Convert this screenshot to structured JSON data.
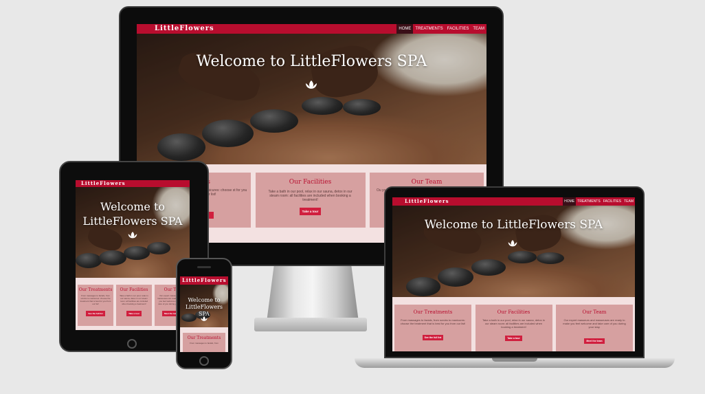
{
  "site": {
    "logo": "LittleFlowers",
    "nav": [
      "HOME",
      "TREATMENTS",
      "FACILITIES",
      "TEAM"
    ],
    "hero_title": "Welcome to LittleFlowers SPA",
    "cards": [
      {
        "title": "Our Treatments",
        "text": "From massages to facials, from scrubs to manicures: choose the treatment that is best for you from our list!",
        "button": "See the full list"
      },
      {
        "title": "Our Facilities",
        "text": "Take a bath in our pool, relax in our sauna, detox in our steam room: all facilities are included when booking a treatment!",
        "button": "Take a tour"
      },
      {
        "title": "Our Team",
        "text": "Our expert masseurs and masseuses are ready to make you feel welcome and take care of you during your stay.",
        "button": "Meet the team"
      }
    ],
    "monitor_cards": [
      {
        "title": "nts",
        "text": "t to manicures: choose st for you from our list!"
      },
      {
        "title": "Our Facilities",
        "text": "Take a bath in our pool, relax in our sauna, detox in our steam room: all facilities are included when booking a treatment!",
        "button": "Take a tour"
      },
      {
        "title": "Our Team",
        "text": "Ou yo"
      }
    ],
    "tablet_cards": [
      {
        "title": "Our Treatments"
      },
      {
        "title": "Our Facilities"
      },
      {
        "title": "Our Te"
      }
    ],
    "phone_hero_title": "Welcome to LittleFlowers SPA",
    "phone_card_title": "Our Treatments",
    "phone_card_text": "From massages to facials, from"
  },
  "colors": {
    "navbar": "#b80d2e",
    "card_bg": "#d6a0a0",
    "section_bg": "#f3e1e1",
    "button": "#d01f3e",
    "page_bg": "#e8e8e8"
  }
}
